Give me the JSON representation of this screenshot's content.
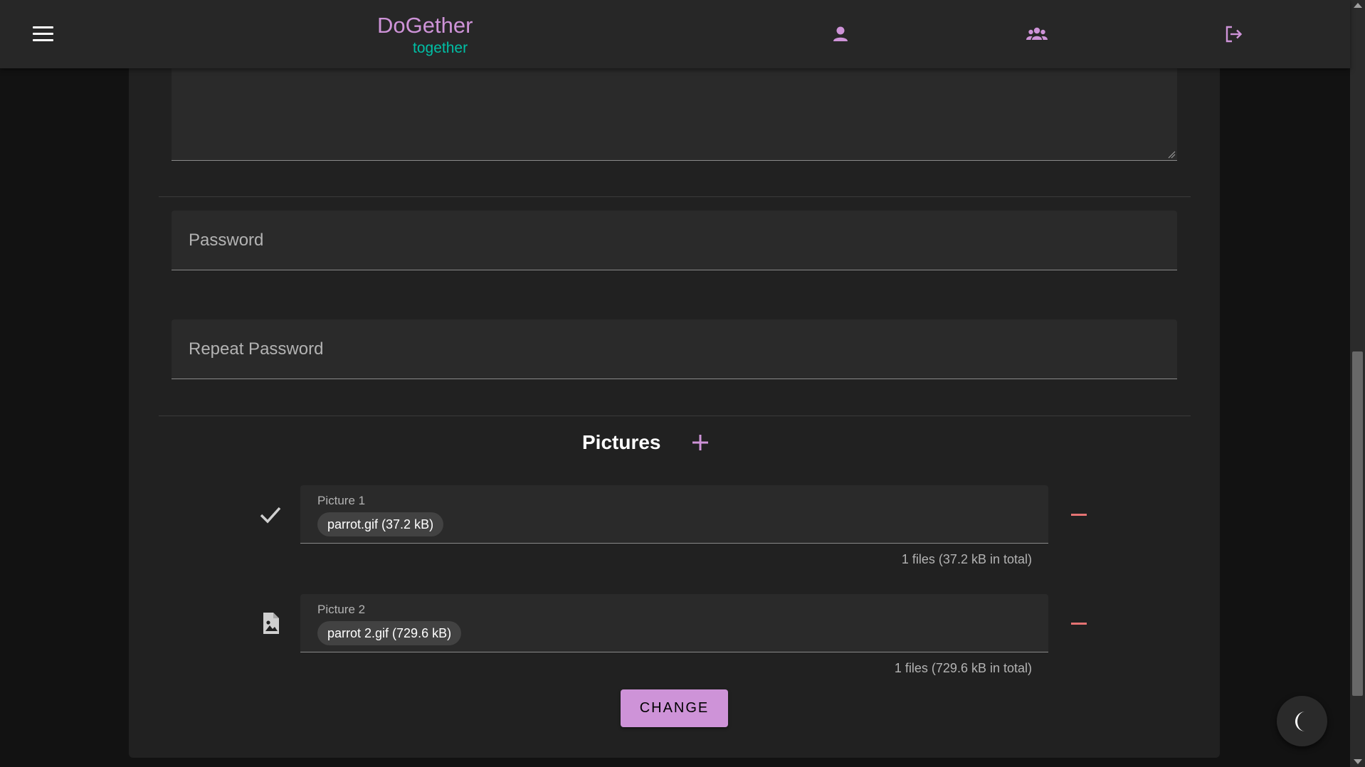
{
  "app": {
    "title": "DoGether",
    "subtitle": "together"
  },
  "nav": {
    "menu_icon": "hamburger-menu-icon",
    "profile_icon": "person-icon",
    "groups_icon": "group-icon",
    "logout_icon": "logout-icon"
  },
  "form": {
    "password_label": "Password",
    "repeat_password_label": "Repeat Password",
    "pictures_title": "Pictures",
    "pictures": [
      {
        "label": "Picture 1",
        "file": "parrot.gif (37.2 kB)",
        "total": "1 files (37.2 kB in total)",
        "status_icon": "check-icon"
      },
      {
        "label": "Picture 2",
        "file": "parrot 2.gif (729.6 kB)",
        "total": "1 files (729.6 kB in total)",
        "status_icon": "image-file-icon"
      }
    ],
    "submit_label": "CHANGE"
  },
  "colors": {
    "accent": "#ce93d8",
    "secondary": "#00bfa5",
    "danger": "#e57373",
    "appbar": "#272727",
    "card": "#212121",
    "background": "#121212"
  }
}
